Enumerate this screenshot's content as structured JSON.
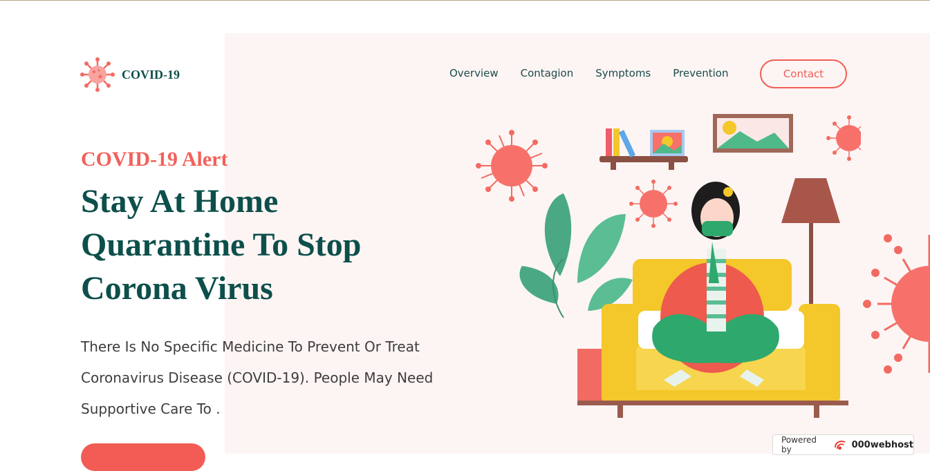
{
  "brand": {
    "name": "COVID-19"
  },
  "nav": {
    "items": [
      "Overview",
      "Contagion",
      "Symptoms",
      "Prevention"
    ],
    "contact_label": "Contact"
  },
  "hero": {
    "eyebrow": "COVID-19 Alert",
    "headline_lines": [
      "Stay At Home",
      "Quarantine To Stop",
      "Corona Virus"
    ],
    "description": "There Is No Specific Medicine To Prevent Or Treat Coronavirus Disease (COVID-19). People May Need Supportive Care To ."
  },
  "badge": {
    "prefix": "Powered by",
    "brand": "000webhost"
  },
  "colors": {
    "accent": "#f25c54",
    "primary": "#0d4f4b",
    "hero_bg": "#fdf5f4"
  },
  "icons": [
    "virus-icon",
    "webhost-icon"
  ]
}
